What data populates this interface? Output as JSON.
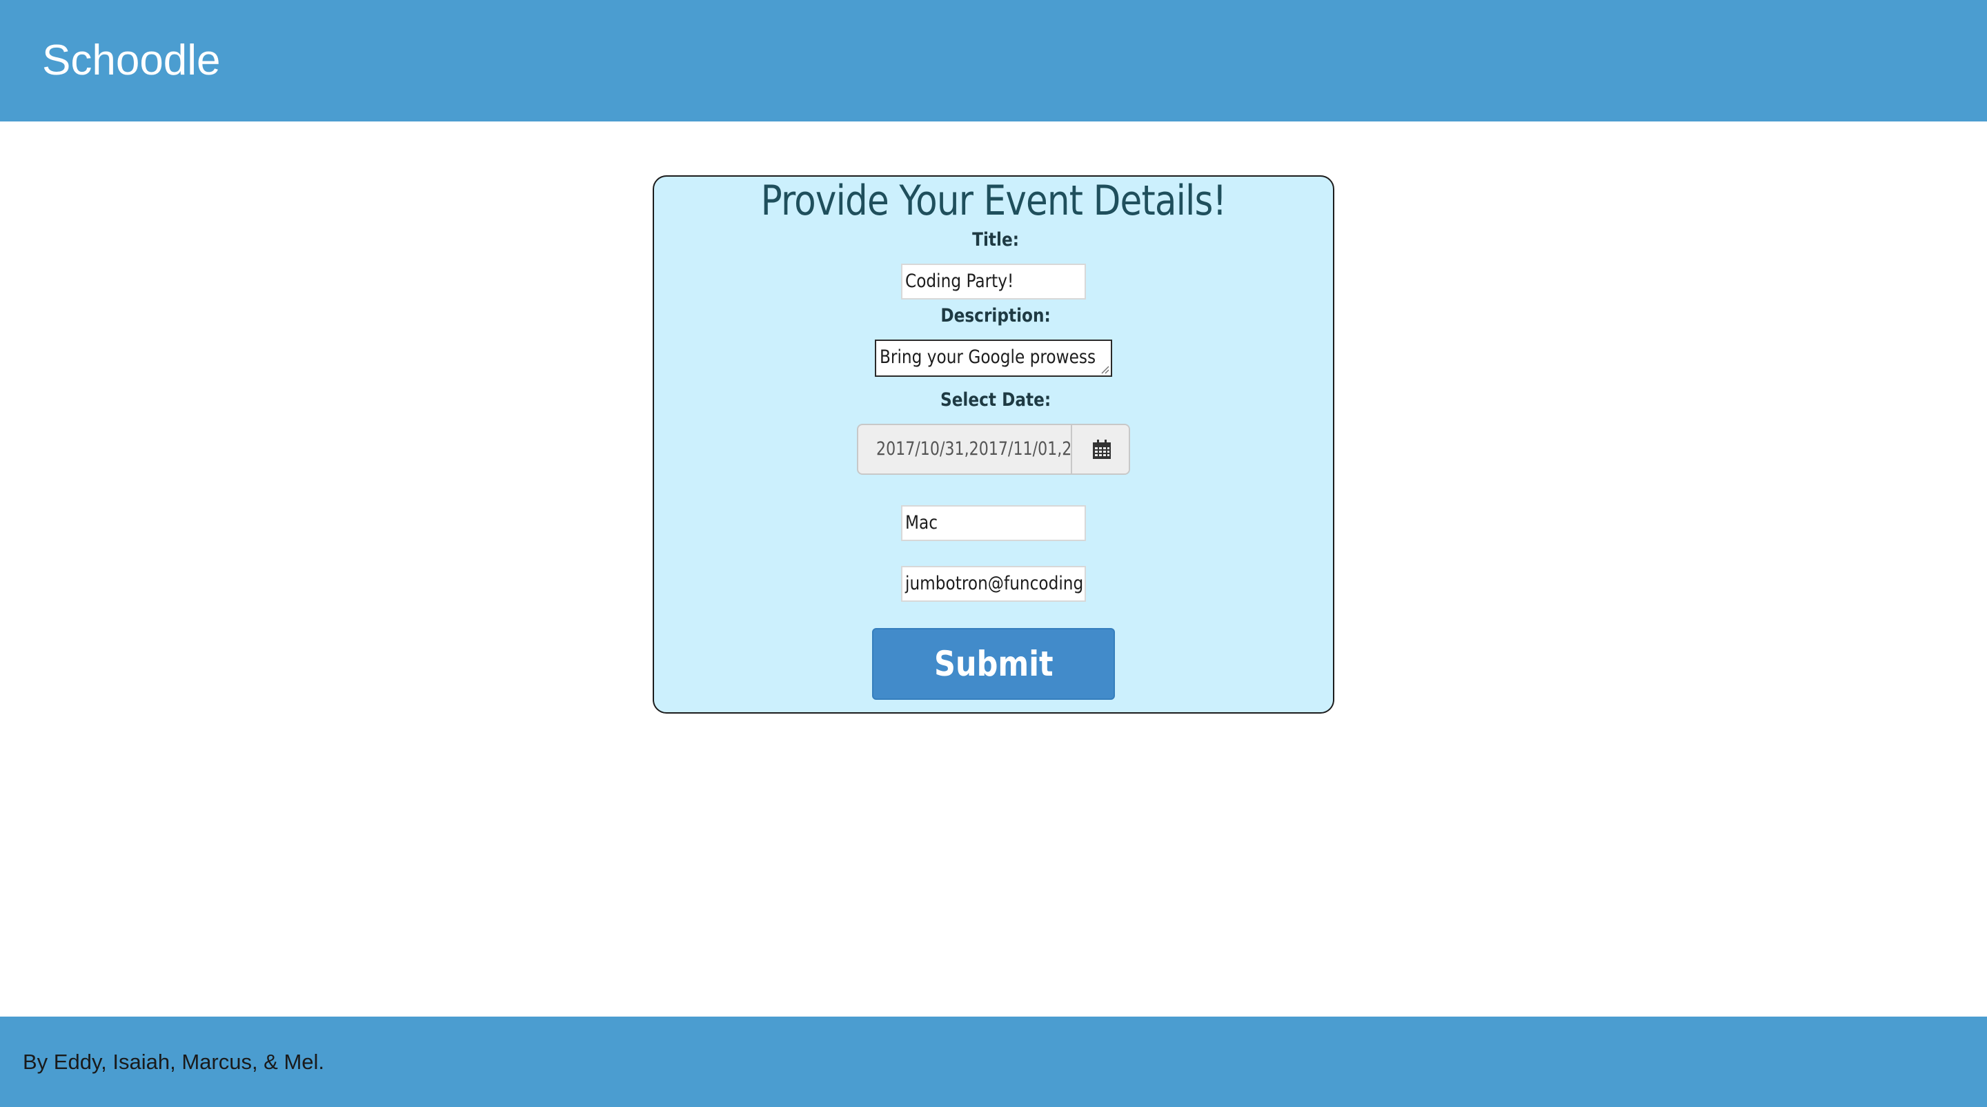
{
  "header": {
    "brand": "Schoodle"
  },
  "form": {
    "heading": "Provide Your Event Details!",
    "title_label": "Title:",
    "title_value": "Coding Party!",
    "description_label": "Description:",
    "description_value": "Bring your Google prowess",
    "date_label": "Select Date:",
    "date_value": "2017/10/31,2017/11/01,2",
    "name_value": "Mac",
    "email_value": "jumbotron@funcoding",
    "submit_label": "Submit"
  },
  "footer": {
    "credits": "By Eddy, Isaiah, Marcus, & Mel."
  },
  "colors": {
    "header_bg": "#4b9dd0",
    "card_bg": "#ccf0fd",
    "submit_bg": "#428bca"
  },
  "icons": {
    "date_picker": "calendar-icon"
  }
}
